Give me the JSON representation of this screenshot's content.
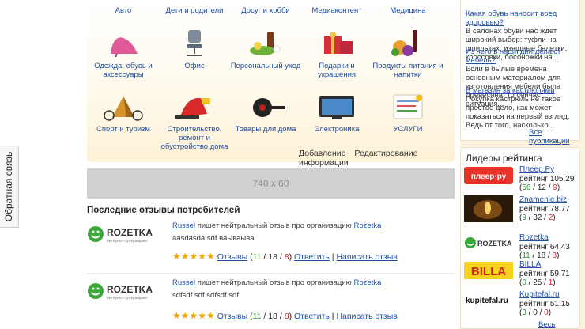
{
  "feedback_tab": "Обратная связь",
  "categories": [
    {
      "label": "Авто",
      "icon": "car-icon"
    },
    {
      "label": "Дети и родители",
      "icon": "children-icon"
    },
    {
      "label": "Досуг и хобби",
      "icon": "hobby-icon"
    },
    {
      "label": "Медиаконтент",
      "icon": "media-icon"
    },
    {
      "label": "Медицина",
      "icon": "medicine-icon"
    },
    {
      "label": "Одежда, обувь и аксессуары",
      "icon": "shoe-icon"
    },
    {
      "label": "Офис",
      "icon": "office-chair-icon"
    },
    {
      "label": "Персональный уход",
      "icon": "personal-care-icon"
    },
    {
      "label": "Подарки и украшения",
      "icon": "gift-icon"
    },
    {
      "label": "Продукты питания и напитки",
      "icon": "food-icon"
    },
    {
      "label": "Спорт и туризм",
      "icon": "tent-bike-icon"
    },
    {
      "label": "Строительство, ремонт и обустройство дома",
      "icon": "construction-icon"
    },
    {
      "label": "Товары для дома",
      "icon": "pan-icon"
    },
    {
      "label": "Электроника",
      "icon": "tv-icon"
    },
    {
      "label": "УСЛУГИ",
      "icon": "services-icon"
    }
  ],
  "panel_links": {
    "add": "Добавление",
    "edit": "Редактирование информации"
  },
  "banner": "740 x 60",
  "reviews_title": "Последние отзывы потребителей",
  "reviews": [
    {
      "logo_text": "ROZETKA",
      "logo_sub": "интернет-супермаркет",
      "user": "Russel",
      "action": "пишет нейтральный отзыв про организацию",
      "org": "Rozetka",
      "text": "aasdasda sdf ваываыва",
      "stars": "★★★★★",
      "reviews_label": "Отзывы",
      "pos": "11",
      "neu": "18",
      "neg": "8",
      "reply": "Ответить",
      "write": "Написать отзыв"
    },
    {
      "logo_text": "ROZETKA",
      "logo_sub": "интернет-супермаркет",
      "user": "Russel",
      "action": "пишет нейтральный отзыв про организацию",
      "org": "Rozetka",
      "text": "sdfsdf sdf sdfsdf sdf",
      "stars": "★★★★★",
      "reviews_label": "Отзывы",
      "pos": "11",
      "neu": "18",
      "neg": "8",
      "reply": "Ответить",
      "write": "Написать отзыв"
    }
  ],
  "publications": [
    {
      "question": "Какая обувь наносит вред здоровью?",
      "body": "В салонах обуви нас ждет широкий выбор: туфли на шпильках, изящные балетки, кроссовки, босоножки на..."
    },
    {
      "question": "Из чего в наши дни делают мебель?",
      "body": "Если в былые времена основным материалом для изготовления мебели была древесина, то сейчас ситуация..."
    },
    {
      "question": "В магазин за кастрюлями",
      "body": "Покупка кастрюль не такое простое дело, как может показаться на первый взгляд. Ведь от того, насколько..."
    }
  ],
  "publications_all": "Все публикации",
  "leaders_title": "Лидеры рейтинга",
  "leaders": [
    {
      "name": "Плеер.Ру",
      "rating_label": "рейтинг",
      "rating": "105.29",
      "pos": "56",
      "neu": "12",
      "neg": "9",
      "thumb_text": "плеер·ру",
      "thumb": "player-logo"
    },
    {
      "name": "Znamenie.biz",
      "rating_label": "рейтинг",
      "rating": "78.77",
      "pos": "9",
      "neu": "32",
      "neg": "2",
      "thumb_text": "",
      "thumb": "candle-photo"
    },
    {
      "name": "Rozetka",
      "rating_label": "рейтинг",
      "rating": "64.43",
      "pos": "11",
      "neu": "18",
      "neg": "8",
      "thumb_text": "ROZETKA",
      "thumb": "rozetka-logo"
    },
    {
      "name": "BILLA",
      "rating_label": "рейтинг",
      "rating": "59.71",
      "pos": "0",
      "neu": "25",
      "neg": "1",
      "thumb_text": "BILLA",
      "thumb": "billa-logo"
    },
    {
      "name": "Kupitefal.ru",
      "rating_label": "рейтинг",
      "rating": "51.15",
      "pos": "3",
      "neu": "0",
      "neg": "0",
      "thumb_text": "kupitefal.ru",
      "thumb": "kupitefal-logo"
    }
  ],
  "leaders_all": "Весь рейтинг",
  "colors": {
    "link": "#1f4fa6",
    "positive": "#2a8f2a",
    "negative": "#c12a2a",
    "star": "#f0a800",
    "panel_bg": "#fdf1d6"
  }
}
